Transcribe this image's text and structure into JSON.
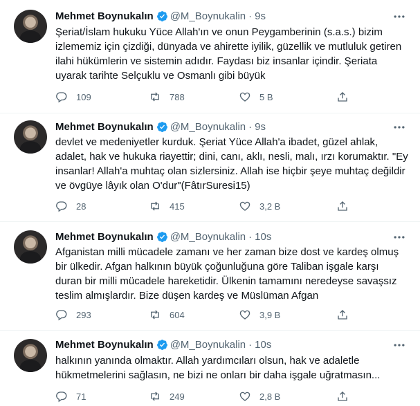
{
  "tweets": [
    {
      "name": "Mehmet Boynukalın",
      "handle": "@M_Boynukalin",
      "time": "9s",
      "text": "Şeriat/İslam hukuku Yüce Allah'ın ve onun Peygamberinin (s.a.s.) bizim izlememiz için çizdiği, dünyada ve ahirette iyilik, güzellik ve mutluluk getiren ilahi hükümlerin ve sistemin adıdır. Faydası biz insanlar içindir. Şeriata uyarak tarihte Selçuklu ve Osmanlı gibi büyük",
      "replies": "109",
      "retweets": "788",
      "likes": "5 B"
    },
    {
      "name": "Mehmet Boynukalın",
      "handle": "@M_Boynukalin",
      "time": "9s",
      "text": "devlet ve medeniyetler kurduk. Şeriat Yüce Allah'a ibadet, güzel ahlak, adalet, hak ve hukuka riayettir; dini, canı, aklı, nesli, malı, ırzı korumaktır. \"Ey insanlar! Allah'a muhtaç olan sizlersiniz. Allah ise hiçbir şeye muhtaç değildir ve övgüye lâyık olan O'dur\"(FâtırSuresi15)",
      "replies": "28",
      "retweets": "415",
      "likes": "3,2 B"
    },
    {
      "name": "Mehmet Boynukalın",
      "handle": "@M_Boynukalin",
      "time": "10s",
      "text": "Afganistan milli mücadele zamanı ve her zaman bize dost ve kardeş olmuş bir ülkedir. Afgan halkının büyük çoğunluğuna göre Taliban işgale karşı duran bir milli mücadele hareketidir. Ülkenin tamamını neredeyse savaşsız teslim almışlardır. Bize düşen kardeş ve Müslüman Afgan",
      "replies": "293",
      "retweets": "604",
      "likes": "3,9 B"
    },
    {
      "name": "Mehmet Boynukalın",
      "handle": "@M_Boynukalin",
      "time": "10s",
      "text": "halkının yanında  olmaktır. Allah yardımcıları olsun, hak ve adaletle hükmetmelerini sağlasın, ne bizi ne onları bir daha işgale uğratmasın...",
      "replies": "71",
      "retweets": "249",
      "likes": "2,8 B"
    }
  ],
  "icons": {
    "verified": "verified-badge-icon",
    "more": "more-horizontal-icon",
    "reply": "reply-icon",
    "retweet": "retweet-icon",
    "like": "heart-icon",
    "share": "share-icon"
  },
  "colors": {
    "verified": "#1d9bf0",
    "secondary_text": "#536471",
    "divider": "#eff3f4"
  }
}
